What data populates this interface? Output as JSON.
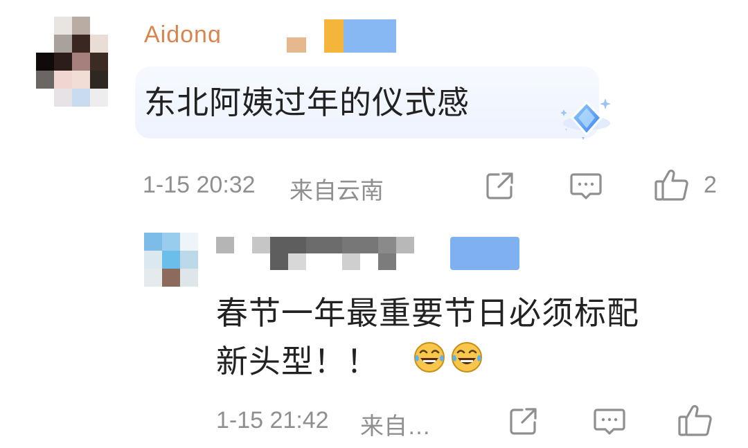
{
  "comment": {
    "username": "Aidong",
    "text": "东北阿姨过年的仪式感",
    "time": "1-15 20:32",
    "location": "来自云南",
    "like_count": "2"
  },
  "reply": {
    "text_line1": "春节一年最重要节日必须标配",
    "text_line2": "新头型！！",
    "time": "1-15 21:42",
    "location": "来自…"
  },
  "icons": {
    "share": "share-icon",
    "comment": "comment-icon",
    "like": "thumbs-up-icon",
    "badge": "diamond-badge-icon",
    "emoji": "laughing-tears-emoji"
  },
  "colors": {
    "username": "#d9844e",
    "meta": "#8f8f8f",
    "text": "#222222",
    "bubble": "#eef3fe",
    "badge": "#5b9cf0"
  }
}
